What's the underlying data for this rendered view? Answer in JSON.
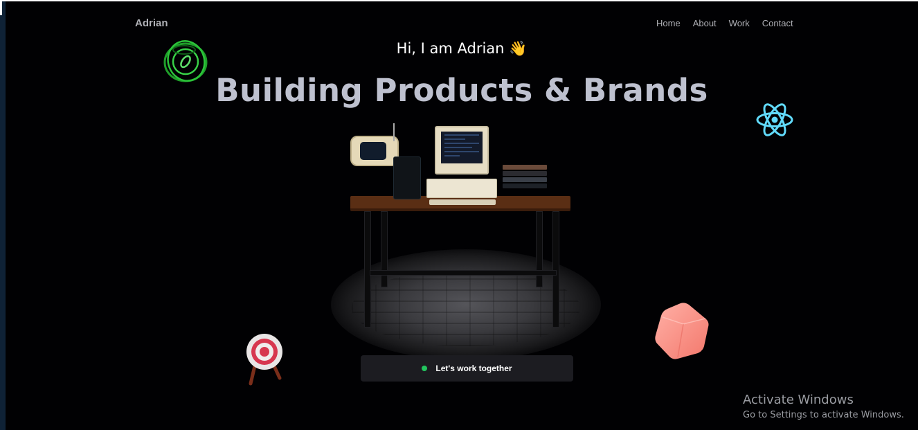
{
  "navbar": {
    "brand": "Adrian",
    "links": [
      "Home",
      "About",
      "Work",
      "Contact"
    ]
  },
  "hero": {
    "greeting": "Hi, I am Adrian 👋",
    "headline": "Building Products & Brands"
  },
  "cta": {
    "label": "Let's work together"
  },
  "watermark": {
    "title": "Activate Windows",
    "subtitle": "Go to Settings to activate Windows."
  },
  "icons": [
    "green-ring-icon",
    "react-logo-icon",
    "archery-target-icon",
    "pink-cube-icon",
    "desk-scene"
  ],
  "colors": {
    "background": "#010103",
    "headline": "#bec1cf",
    "nav_text": "#afb0b6",
    "cta_background": "#1c1c21",
    "status_dot": "#22c55e",
    "react_blue": "#61dafb",
    "cube_pink": "#f98f86"
  }
}
